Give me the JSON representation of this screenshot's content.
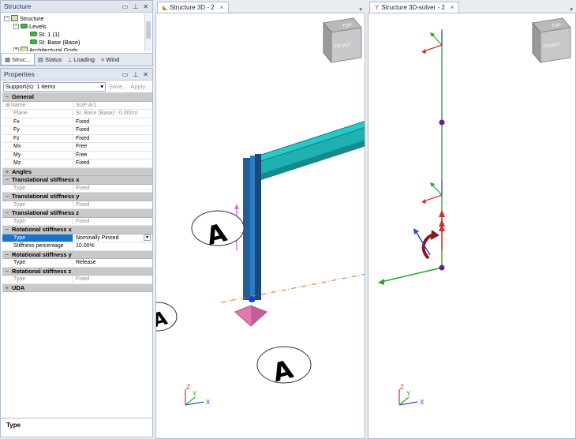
{
  "structure_panel": {
    "title": "Structure",
    "tree": [
      {
        "label": "Structure",
        "level": 0,
        "expander": "−"
      },
      {
        "label": "Levels",
        "level": 1,
        "expander": "−"
      },
      {
        "label": "St. 1 (1)",
        "level": 2
      },
      {
        "label": "St. Base (Base)",
        "level": 2
      },
      {
        "label": "Architectural Grids",
        "level": 1,
        "expander": "+"
      }
    ],
    "tabs": [
      "Struc...",
      "Status",
      "Loading",
      "Wind"
    ]
  },
  "properties_panel": {
    "title": "Properties",
    "selector": "Support(s): 1 items",
    "save_label": "Save...",
    "apply_label": "Apply...",
    "groups": [
      {
        "name": "General",
        "pm": "−",
        "rows": [
          {
            "k": "Name",
            "v": "SUP A/1",
            "ro": true,
            "plus": true
          },
          {
            "k": "Plane",
            "v": "St. Base (Base) : 0.000m",
            "ro": true
          },
          {
            "k": "Fx",
            "v": "Fixed"
          },
          {
            "k": "Fy",
            "v": "Fixed"
          },
          {
            "k": "Fz",
            "v": "Fixed"
          },
          {
            "k": "Mx",
            "v": "Free"
          },
          {
            "k": "My",
            "v": "Free"
          },
          {
            "k": "Mz",
            "v": "Fixed"
          }
        ]
      },
      {
        "name": "Angles",
        "pm": "+",
        "rows": []
      },
      {
        "name": "Translational stiffness x",
        "pm": "−",
        "rows": [
          {
            "k": "Type",
            "v": "Fixed",
            "ro": true
          }
        ]
      },
      {
        "name": "Translational stiffness y",
        "pm": "−",
        "rows": [
          {
            "k": "Type",
            "v": "Fixed",
            "ro": true
          }
        ]
      },
      {
        "name": "Translational stiffness z",
        "pm": "−",
        "rows": [
          {
            "k": "Type",
            "v": "Fixed",
            "ro": true
          }
        ]
      },
      {
        "name": "Rotational stiffness x",
        "pm": "−",
        "rows": [
          {
            "k": "Type",
            "v": "Nominally Pinned",
            "sel": true,
            "dropdown": true
          },
          {
            "k": "Stiffness percentage",
            "v": "10.00%"
          }
        ]
      },
      {
        "name": "Rotational stiffness y",
        "pm": "−",
        "rows": [
          {
            "k": "Type",
            "v": "Release"
          }
        ]
      },
      {
        "name": "Rotational stiffness z",
        "pm": "−",
        "rows": [
          {
            "k": "Type",
            "v": "Fixed",
            "ro": true
          }
        ]
      },
      {
        "name": "UDA",
        "pm": "+",
        "rows": []
      }
    ],
    "description_title": "Type"
  },
  "viewport_left": {
    "tab": "Structure 3D - 2",
    "cube_top": "TOP",
    "cube_front": "FRONT",
    "grid_label": "A",
    "axis_x": "X",
    "axis_y": "Y",
    "axis_z": "Z"
  },
  "viewport_right": {
    "tab": "Structure 3D-solver - 2",
    "cube_top": "TOP",
    "cube_front": "FRONT",
    "axis_x": "X",
    "axis_y": "Y",
    "axis_z": "Z"
  },
  "colors": {
    "selection": "#1874d1",
    "beam": "#1aa3a3",
    "column": "#1f5f9a",
    "support": "#e07ab0",
    "accent_blue": "#1e3a5f"
  }
}
